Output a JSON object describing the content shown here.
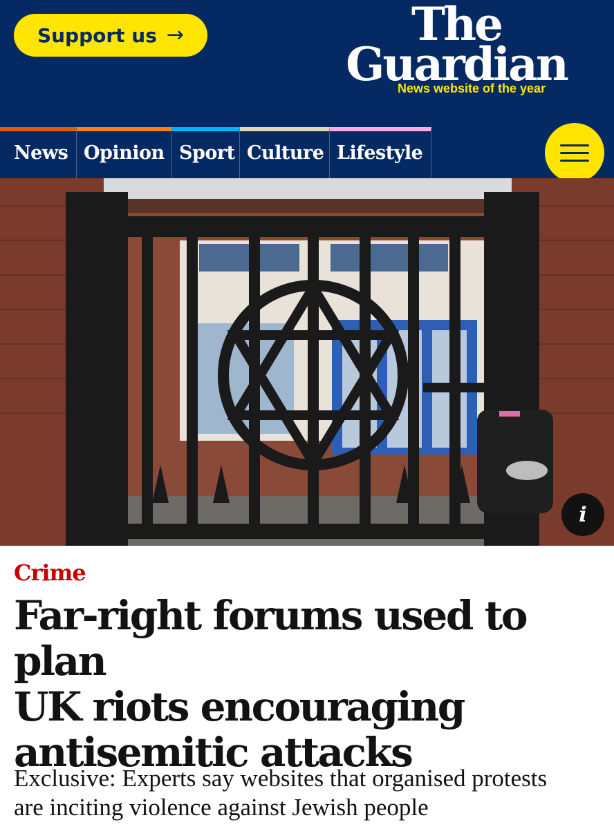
{
  "header": {
    "support_label": "Support us",
    "support_arrow": "→",
    "logo_line1": "The",
    "logo_line2": "Guardian",
    "tagline": "News website of the year",
    "colors": {
      "background": "#052962",
      "accent": "#ffe500"
    }
  },
  "nav": {
    "items": [
      {
        "label": "News",
        "color": "#e05e00"
      },
      {
        "label": "Opinion",
        "color": "#ff7f0f"
      },
      {
        "label": "Sport",
        "color": "#00b2ff"
      },
      {
        "label": "Culture",
        "color": "#e7d4b9"
      },
      {
        "label": "Lifestyle",
        "color": "#ffabdb"
      }
    ],
    "menu_icon": "hamburger-menu-icon"
  },
  "hero": {
    "info_label": "i",
    "icon": "info-icon"
  },
  "article": {
    "kicker": "Crime",
    "headline_lines": [
      "Far-right forums used to plan",
      "UK riots encouraging",
      "antisemitic attacks"
    ],
    "standfirst_lines": [
      "Exclusive: Experts say websites that organised protests",
      "are inciting violence against Jewish people"
    ],
    "kicker_color": "#c70000"
  }
}
